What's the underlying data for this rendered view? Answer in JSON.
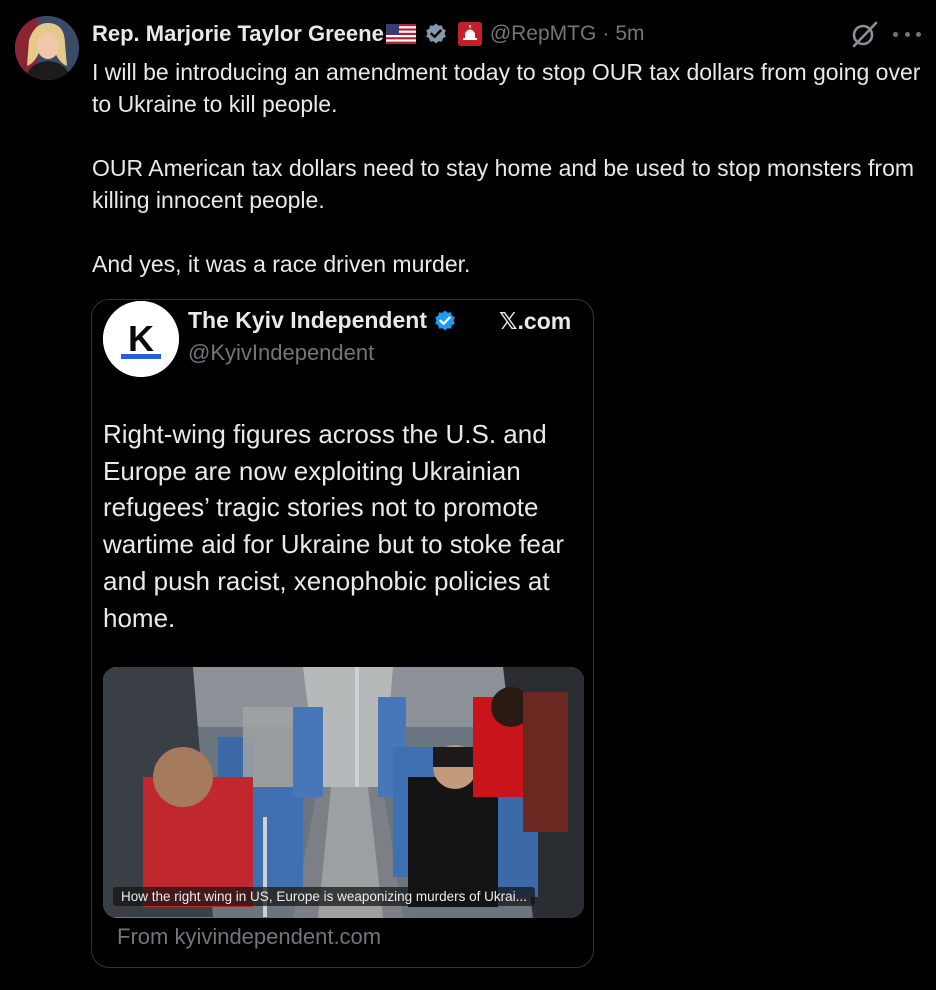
{
  "author": {
    "display_name": "Rep. Marjorie Taylor Greene",
    "handle": "@RepMTG",
    "separator": "·",
    "time": "5m"
  },
  "tweet": {
    "paragraphs": [
      "I will be introducing an amendment today to stop OUR tax dollars from going over to Ukraine to kill people.",
      "OUR American tax dollars need to stay home and be used to stop monsters from killing innocent people.",
      "And yes, it was a race driven murder."
    ]
  },
  "quoted": {
    "avatar_letter": "K",
    "name": "The Kyiv Independent",
    "handle": "@KyivIndependent",
    "site_label": "𝕏.com",
    "text": "Right-wing figures across the U.S. and Europe are now exploiting Ukrainian refugees’ tragic stories not to promote wartime aid for Ukraine but to stoke fear and push racist, xenophobic policies at home.",
    "video_caption": "How the right wing in US, Europe is weaponizing murders of Ukrai...",
    "from_text": "From kyivindependent.com"
  },
  "colors": {
    "background": "#000000",
    "text_primary": "#e7e9ea",
    "text_secondary": "#71767b",
    "verified_blue": "#1d9bf0",
    "gov_badge_gray": "#829aab"
  },
  "icons": [
    "us-flag-icon",
    "verified-badge-icon",
    "capitol-badge-icon",
    "grok-icon",
    "more-icon",
    "verified-badge-icon"
  ]
}
